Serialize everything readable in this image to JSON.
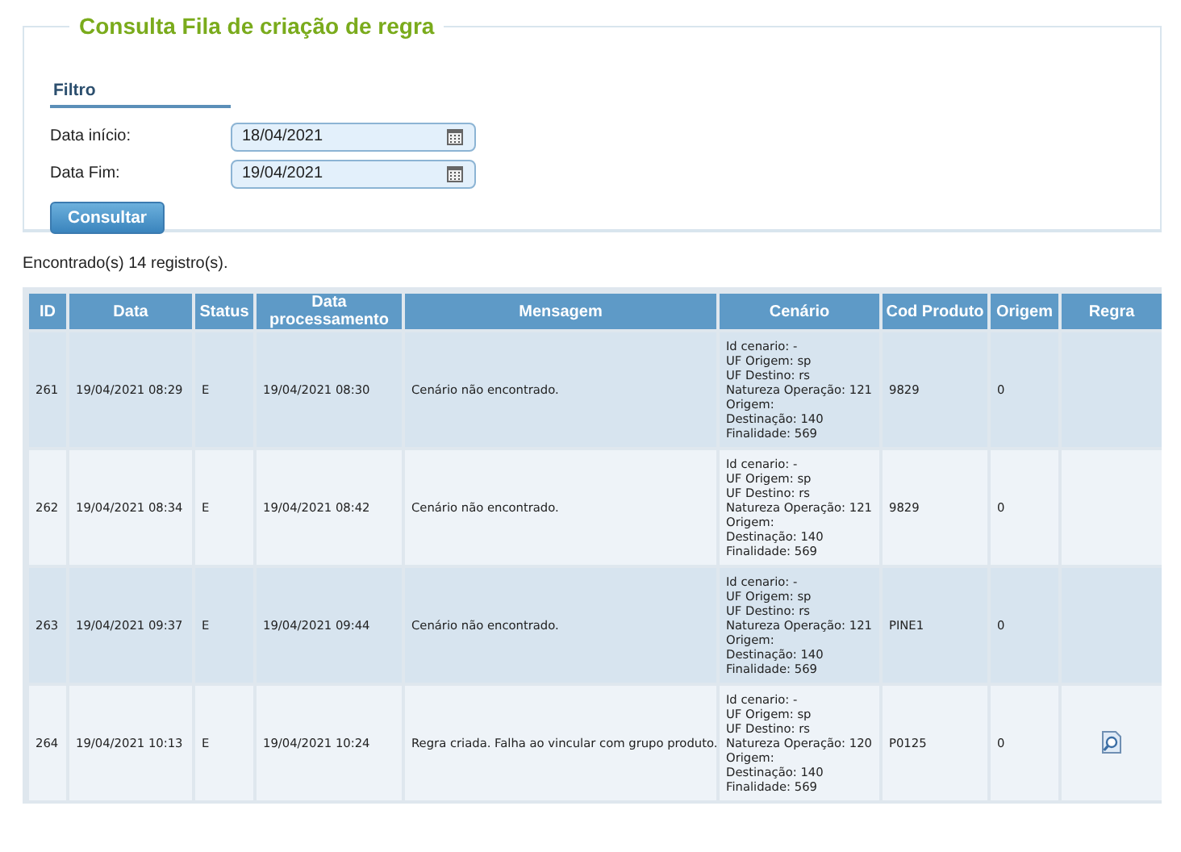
{
  "panel": {
    "title": "Consulta Fila de criação de regra"
  },
  "filter": {
    "heading": "Filtro",
    "fields": [
      {
        "label": "Data início:",
        "value": "18/04/2021"
      },
      {
        "label": "Data Fim:",
        "value": "19/04/2021"
      }
    ],
    "button": "Consultar"
  },
  "result_count": "Encontrado(s) 14 registro(s).",
  "table": {
    "columns": [
      "ID",
      "Data",
      "Status",
      "Data processamento",
      "Mensagem",
      "Cenário",
      "Cod Produto",
      "Origem",
      "Regra"
    ],
    "rows": [
      {
        "id": "261",
        "data": "19/04/2021 08:29",
        "status": "E",
        "data_processamento": "19/04/2021 08:30",
        "mensagem": "Cenário não encontrado.",
        "cenario": [
          "Id cenario: -",
          "UF Origem: sp",
          "UF Destino: rs",
          "Natureza Operação: 121",
          "Origem:",
          "Destinação: 140",
          "Finalidade: 569"
        ],
        "cod_produto": "9829",
        "origem": "0",
        "rule_link": false
      },
      {
        "id": "262",
        "data": "19/04/2021 08:34",
        "status": "E",
        "data_processamento": "19/04/2021 08:42",
        "mensagem": "Cenário não encontrado.",
        "cenario": [
          "Id cenario: -",
          "UF Origem: sp",
          "UF Destino: rs",
          "Natureza Operação: 121",
          "Origem:",
          "Destinação: 140",
          "Finalidade: 569"
        ],
        "cod_produto": "9829",
        "origem": "0",
        "rule_link": false
      },
      {
        "id": "263",
        "data": "19/04/2021 09:37",
        "status": "E",
        "data_processamento": "19/04/2021 09:44",
        "mensagem": "Cenário não encontrado.",
        "cenario": [
          "Id cenario: -",
          "UF Origem: sp",
          "UF Destino: rs",
          "Natureza Operação: 121",
          "Origem:",
          "Destinação: 140",
          "Finalidade: 569"
        ],
        "cod_produto": "PINE1",
        "origem": "0",
        "rule_link": false
      },
      {
        "id": "264",
        "data": "19/04/2021 10:13",
        "status": "E",
        "data_processamento": "19/04/2021 10:24",
        "mensagem": "Regra criada. Falha ao vincular com grupo produto.",
        "cenario": [
          "Id cenario: -",
          "UF Origem: sp",
          "UF Destino: rs",
          "Natureza Operação: 120",
          "Origem:",
          "Destinação: 140",
          "Finalidade: 569"
        ],
        "cod_produto": "P0125",
        "origem": "0",
        "rule_link": true
      }
    ]
  }
}
